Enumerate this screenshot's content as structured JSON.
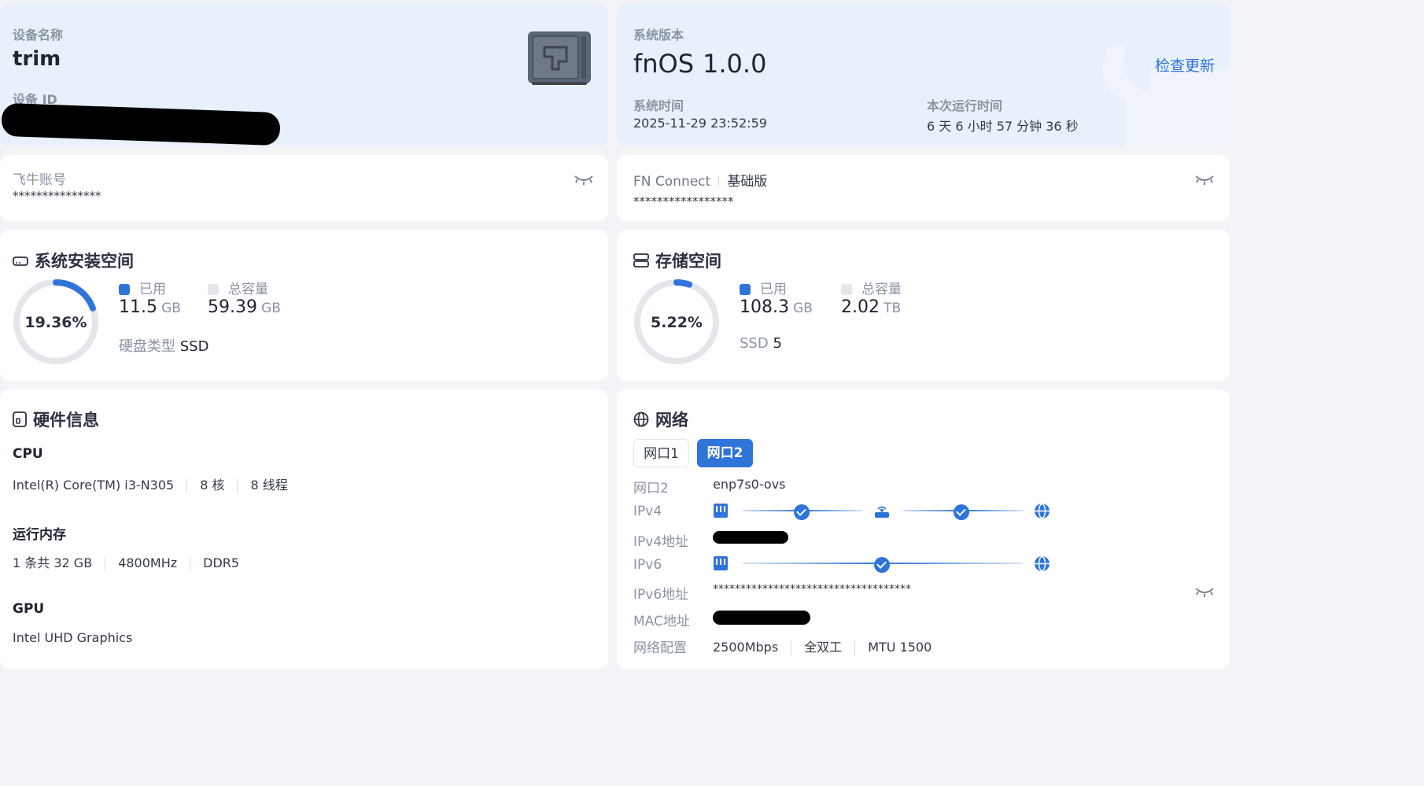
{
  "device": {
    "name_label": "设备名称",
    "name": "trim",
    "id_label": "设备 ID"
  },
  "system": {
    "version_label": "系统版本",
    "os_name": "fnOS",
    "os_version": "1.0.0",
    "check_update": "检查更新",
    "time_label": "系统时间",
    "time": "2025-11-29 23:52:59",
    "uptime_label": "本次运行时间",
    "uptime": "6 天 6 小时 57 分钟 36 秒"
  },
  "account": {
    "label": "飞牛账号",
    "value": "***************"
  },
  "connect": {
    "label": "FN Connect",
    "tier": "基础版",
    "value": "*****************"
  },
  "sys_space": {
    "title": "系统安装空间",
    "percent_text": "19.36%",
    "percent": 0.1936,
    "used_label": "已用",
    "used": "11.5",
    "used_unit": "GB",
    "total_label": "总容量",
    "total": "59.39",
    "total_unit": "GB",
    "disk_type_label": "硬盘类型",
    "disk_type": "SSD"
  },
  "storage": {
    "title": "存储空间",
    "percent_text": "5.22%",
    "percent": 0.0522,
    "used_label": "已用",
    "used": "108.3",
    "used_unit": "GB",
    "total_label": "总容量",
    "total": "2.02",
    "total_unit": "TB",
    "ssd_label": "SSD",
    "ssd_count": "5"
  },
  "hardware": {
    "title": "硬件信息",
    "cpu_label": "CPU",
    "cpu_model": "Intel(R) Core(TM) i3-N305",
    "cpu_cores": "8 核",
    "cpu_threads": "8 线程",
    "mem_label": "运行内存",
    "mem_size": "1 条共 32 GB",
    "mem_freq": "4800MHz",
    "mem_type": "DDR5",
    "gpu_label": "GPU",
    "gpu_model": "Intel UHD Graphics"
  },
  "network": {
    "title": "网络",
    "tabs": [
      "网口1",
      "网口2"
    ],
    "active_tab": 1,
    "port_label": "网口2",
    "port_value": "enp7s0-ovs",
    "ipv4_label": "IPv4",
    "ipv4_addr_label": "IPv4地址",
    "ipv6_label": "IPv6",
    "ipv6_addr_label": "IPv6地址",
    "ipv6_addr": "************************************",
    "mac_label": "MAC地址",
    "config_label": "网络配置",
    "speed": "2500Mbps",
    "duplex": "全双工",
    "mtu": "MTU 1500"
  },
  "colors": {
    "accent": "#2f74d9",
    "track": "#e3e6eb",
    "card_blue": "#e8f0fb"
  }
}
